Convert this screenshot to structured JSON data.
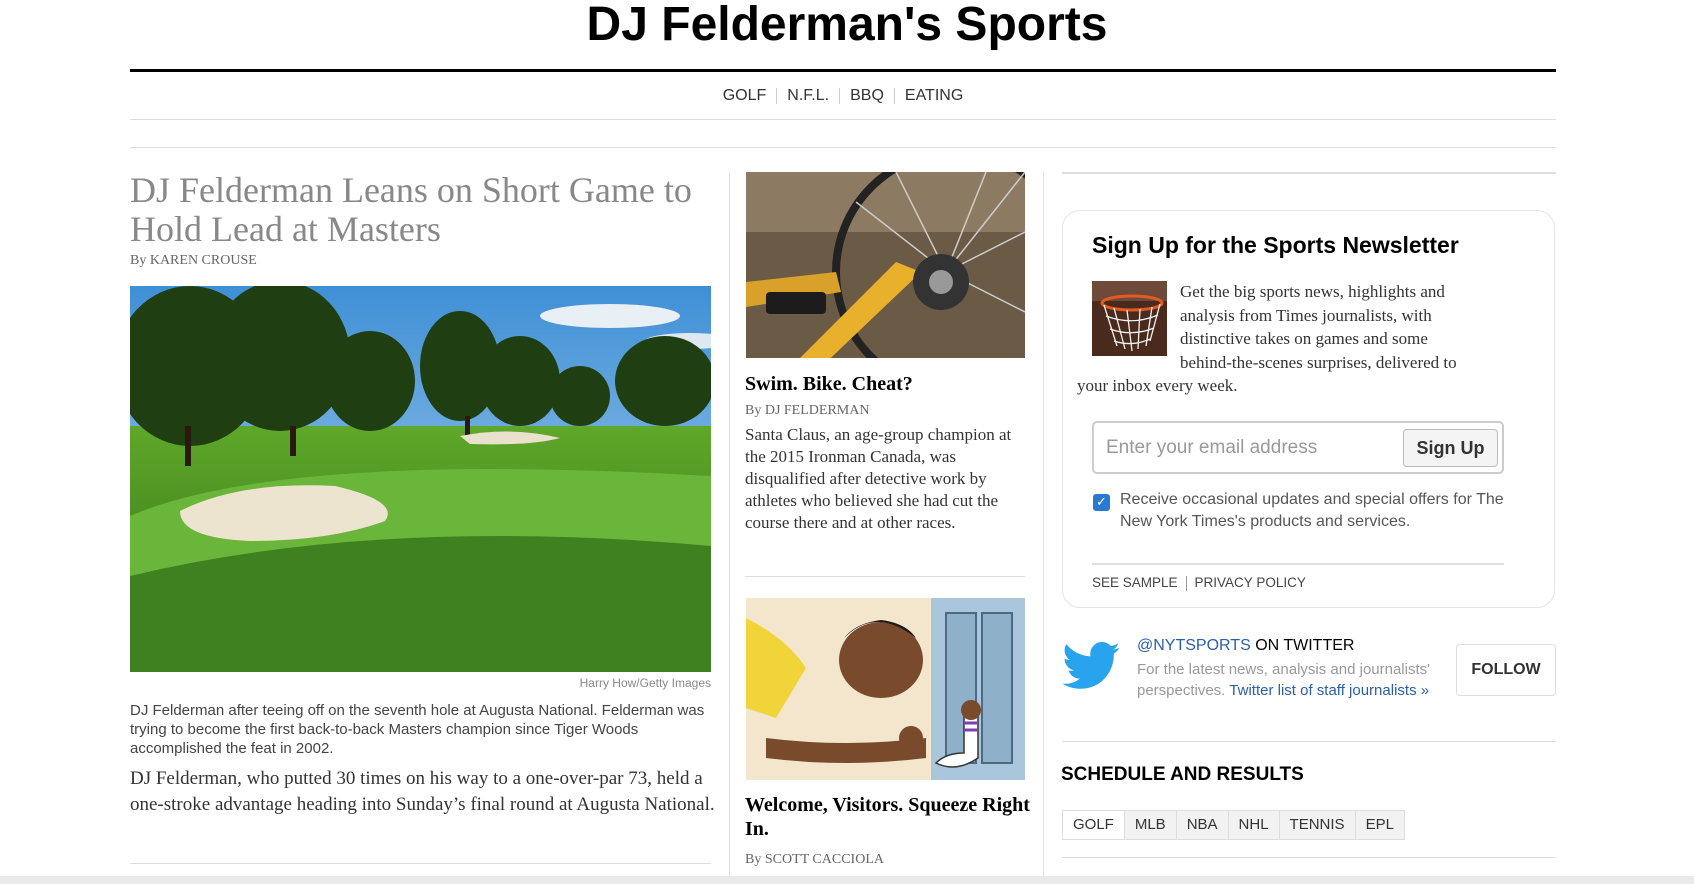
{
  "masthead": {
    "title": "DJ Felderman's Sports"
  },
  "nav": {
    "items": [
      "GOLF",
      "N.F.L.",
      "BBQ",
      "EATING"
    ]
  },
  "lead": {
    "headline": "DJ Felderman Leans on Short Game to Hold Lead at Masters",
    "byline": "By KAREN CROUSE",
    "image_credit": "Harry How/Getty Images",
    "caption": "DJ Felderman after teeing off on the seventh hole at Augusta National. Felderman was trying to become the first back-to-back Masters champion since Tiger Woods accomplished the feat in 2002.",
    "summary": "DJ Felderman, who putted 30 times on his way to a one-over-par 73, held a one-stroke advantage heading into Sunday’s final round at Augusta National."
  },
  "stories": [
    {
      "title": "Swim. Bike. Cheat?",
      "byline": "By DJ FELDERMAN",
      "summary": "Santa Claus, an age-group champion at the 2015 Ironman Canada, was disqualified after detective work by athletes who believed she had cut the course there and at other races."
    },
    {
      "title": "Welcome, Visitors. Squeeze Right In.",
      "byline": "By SCOTT CACCIOLA"
    }
  ],
  "newsletter": {
    "title": "Sign Up for the Sports Newsletter",
    "text_lines": [
      "Get the big sports news, highlights and",
      "analysis from Times journalists, with",
      "distinctive takes on games and some",
      "behind-the-scenes surprises, delivered to",
      "your inbox every week."
    ],
    "email_placeholder": "Enter your email address",
    "signup_label": "Sign Up",
    "checkbox_checked": true,
    "checkbox_label": "Receive occasional updates and special offers for The New York Times's products and services.",
    "see_sample": "SEE SAMPLE",
    "privacy_policy": "PRIVACY POLICY"
  },
  "twitter": {
    "handle": "@NYTSPORTS",
    "on_label": " ON TWITTER",
    "desc": "For the latest news, analysis and journalists' perspectives. ",
    "link": "Twitter list of staff journalists »",
    "follow_label": "FOLLOW"
  },
  "schedule": {
    "title": "SCHEDULE AND RESULTS",
    "tabs": [
      "GOLF",
      "MLB",
      "NBA",
      "NHL",
      "TENNIS",
      "EPL"
    ],
    "active_tab": "GOLF"
  },
  "colors": {
    "link_blue": "#2a5ea8",
    "twitter_blue": "#2aa3ef",
    "checkbox_blue": "#2a7ad2"
  }
}
